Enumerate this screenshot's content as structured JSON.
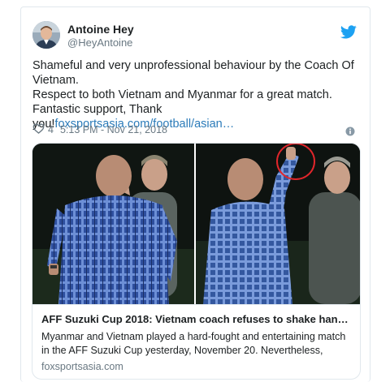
{
  "author": {
    "name": "Antoine Hey",
    "handle": "@HeyAntoine"
  },
  "tweet": {
    "lines": [
      "Shameful and very unprofessional  behaviour by the Coach Of Vietnam.",
      "Respect to both Vietnam and Myanmar for a great match.",
      "Fantastic support, Thank you!"
    ],
    "link": "foxsportsasia.com/football/asian…"
  },
  "meta": {
    "likes": "4",
    "timestamp": "5:13 PM - Nov 21, 2018"
  },
  "card": {
    "title": "AFF Suzuki Cup 2018: Vietnam coach refuses to shake hands …",
    "description": "Myanmar and Vietnam played a hard-fought and entertaining match in the AFF Suzuki Cup yesterday, November 20. Nevertheless,",
    "domain": "foxsportsasia.com"
  },
  "icons": {
    "brand": "twitter-bird-icon",
    "like": "heart-icon",
    "info": "info-icon"
  },
  "colors": {
    "link": "#2b7bb9",
    "twitter_blue": "#1da1f2",
    "muted": "#697882",
    "highlight_circle": "#e0262b"
  }
}
